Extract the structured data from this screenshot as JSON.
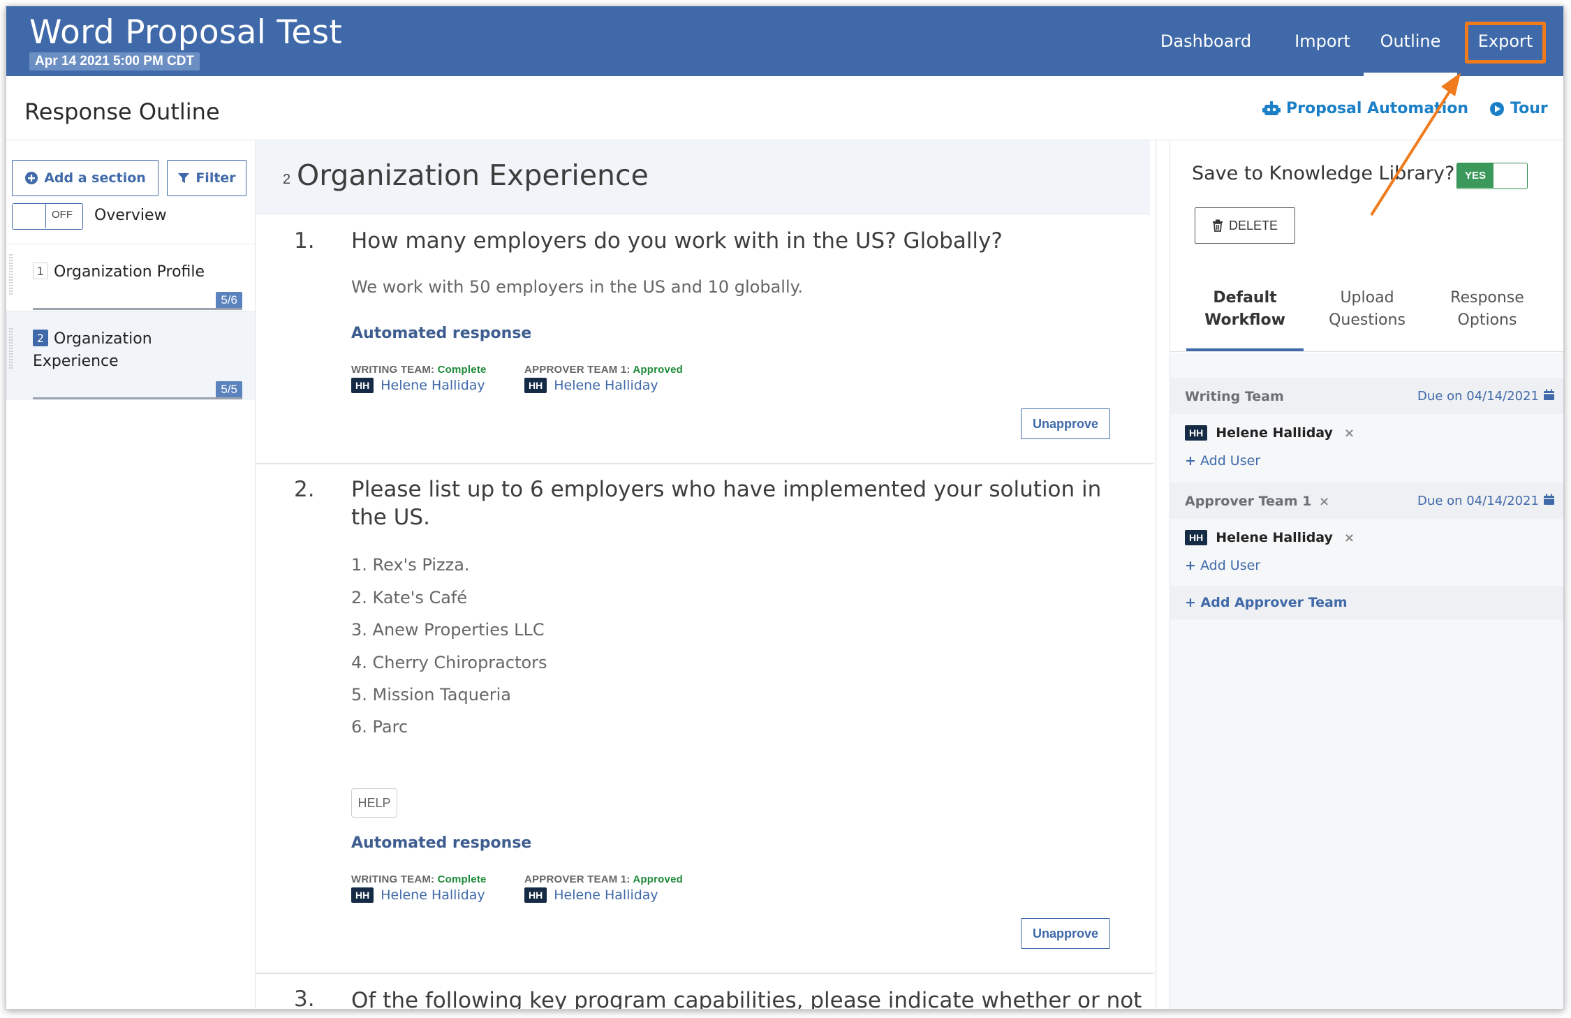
{
  "header": {
    "app_title": "Word Proposal Test",
    "date": "Apr 14 2021 5:00 PM CDT",
    "nav": [
      {
        "label": "Dashboard"
      },
      {
        "label": "Import"
      },
      {
        "label": "Outline"
      },
      {
        "label": "Export"
      }
    ],
    "active_nav": "Outline",
    "highlight_color": "#f07b1c",
    "brand_color": "#3f69a8"
  },
  "subheader": {
    "title": "Response Outline",
    "proposal_automation": "Proposal Automation",
    "tour": "Tour"
  },
  "sidebar": {
    "add_section": "Add a section",
    "filter": "Filter",
    "toggle_state": "OFF",
    "overview": "Overview",
    "sections": [
      {
        "num": "1",
        "label": "Organization Profile",
        "count": "5/6"
      },
      {
        "num": "2",
        "label": "Organization Experience",
        "count": "5/5"
      }
    ]
  },
  "main": {
    "section_num": "2",
    "section_title": "Organization Experience",
    "questions": [
      {
        "num": "1.",
        "text": "How many employers do you work with in the US? Globally?",
        "answer": "We work with 50 employers in the US and 10 globally.",
        "automated": "Automated response",
        "writing_label": "WRITING TEAM:",
        "writing_status": "Complete",
        "approver_label": "APPROVER TEAM 1:",
        "approver_status": "Approved",
        "user_initials": "HH",
        "user_name": "Helene Halliday",
        "button": "Unapprove"
      },
      {
        "num": "2.",
        "text": "Please list up to 6 employers who have implemented your solution in the US.",
        "answers": [
          "1. Rex's Pizza.",
          "2. Kate's Café",
          "3. Anew Properties LLC",
          "4. Cherry Chiropractors",
          "5. Mission Taqueria",
          "6. Parc"
        ],
        "help": "HELP",
        "automated": "Automated response",
        "writing_label": "WRITING TEAM:",
        "writing_status": "Complete",
        "approver_label": "APPROVER TEAM 1:",
        "approver_status": "Approved",
        "user_initials": "HH",
        "user_name": "Helene Halliday",
        "button": "Unapprove"
      },
      {
        "num": "3.",
        "text": "Of the following key program capabilities, please indicate whether or not"
      }
    ]
  },
  "rpanel": {
    "knowledge_label": "Save to Knowledge Library?",
    "toggle_state": "YES",
    "delete": "DELETE",
    "tabs": [
      {
        "line1": "Default",
        "line2": "Workflow"
      },
      {
        "line1": "Upload",
        "line2": "Questions"
      },
      {
        "line1": "Response",
        "line2": "Options"
      }
    ],
    "writing_team": {
      "name": "Writing Team",
      "due": "Due on 04/14/2021",
      "user_initials": "HH",
      "user": "Helene Halliday",
      "add_user": "Add User"
    },
    "approver_team": {
      "name": "Approver Team 1",
      "due": "Due on 04/14/2021",
      "user_initials": "HH",
      "user": "Helene Halliday",
      "add_user": "Add User"
    },
    "add_approver_team": "Add Approver Team"
  }
}
